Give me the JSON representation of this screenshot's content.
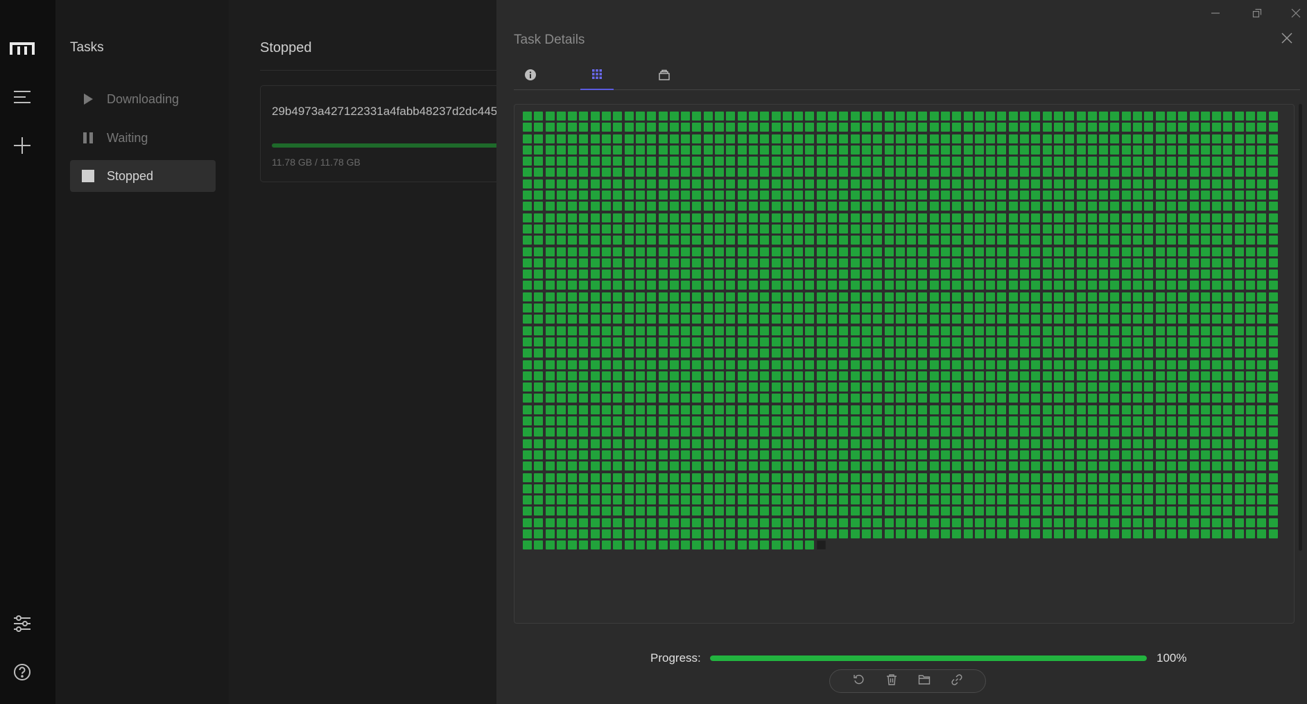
{
  "window": {
    "controls": [
      "minimize-icon",
      "maximize-icon",
      "close-icon"
    ]
  },
  "rail": {
    "icons": [
      "logo-icon",
      "menu-icon",
      "add-icon",
      "settings-sliders-icon",
      "help-icon"
    ]
  },
  "sidebar": {
    "title": "Tasks",
    "items": [
      {
        "label": "Downloading",
        "icon": "play-icon",
        "active": false
      },
      {
        "label": "Waiting",
        "icon": "pause-icon",
        "active": false
      },
      {
        "label": "Stopped",
        "icon": "stop-icon",
        "active": true
      }
    ]
  },
  "main": {
    "title": "Stopped",
    "task": {
      "name": "29b4973a427122331a4fabb48237d2dc445",
      "size": "11.78 GB / 11.78 GB",
      "progress": 1.0
    }
  },
  "details": {
    "title": "Task Details",
    "tabs": [
      {
        "icon": "info-icon",
        "active": false
      },
      {
        "icon": "grid-icon",
        "active": true
      },
      {
        "icon": "files-icon",
        "active": false
      }
    ],
    "pieces": {
      "columns": 67,
      "completed": 2572,
      "incomplete": 1,
      "colors": {
        "done": "#21a33b",
        "pending": "#1e1e1e"
      }
    },
    "progress_label": "Progress:",
    "progress_value": "100%",
    "progress_fraction": 1.0,
    "actions": [
      "restart-icon",
      "delete-icon",
      "folder-icon",
      "link-icon"
    ]
  },
  "colors": {
    "accent": "#5b5be0",
    "success": "#22b33f"
  }
}
